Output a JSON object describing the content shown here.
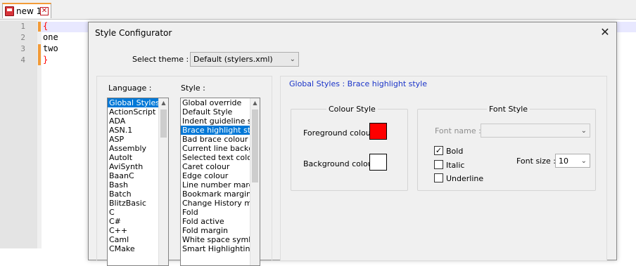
{
  "editor": {
    "tab_label": "new 1",
    "line_numbers": [
      "1",
      "2",
      "3",
      "4"
    ],
    "lines": [
      "{",
      "one",
      "two",
      "}"
    ]
  },
  "dialog": {
    "title": "Style Configurator",
    "close_glyph": "✕",
    "select_theme_label": "Select theme :",
    "theme_value": "Default (stylers.xml)",
    "language_label": "Language :",
    "style_label": "Style :",
    "languages": [
      "Global Styles",
      "ActionScript",
      "ADA",
      "ASN.1",
      "ASP",
      "Assembly",
      "AutoIt",
      "AviSynth",
      "BaanC",
      "Bash",
      "Batch",
      "BlitzBasic",
      "C",
      "C#",
      "C++",
      "Caml",
      "CMake"
    ],
    "selected_language": "Global Styles",
    "styles": [
      "Global override",
      "Default Style",
      "Indent guideline sty",
      "Brace highlight styl",
      "Bad brace colour",
      "Current line backgr",
      "Selected text colou",
      "Caret colour",
      "Edge colour",
      "Line number margin",
      "Bookmark margin",
      "Change History ma",
      "Fold",
      "Fold active",
      "Fold margin",
      "White space symbo",
      "Smart Highlighting"
    ],
    "selected_style": "Brace highlight styl",
    "style_heading": "Global Styles : Brace highlight style",
    "colour_style": {
      "legend": "Colour Style",
      "foreground_label": "Foreground colour",
      "background_label": "Background colour",
      "foreground_color": "#ff0000",
      "background_color": "#ffffff"
    },
    "font_style": {
      "legend": "Font Style",
      "font_name_label": "Font name :",
      "font_name_value": "",
      "bold_label": "Bold",
      "bold_checked": true,
      "italic_label": "Italic",
      "italic_checked": false,
      "underline_label": "Underline",
      "underline_checked": false,
      "font_size_label": "Font size :",
      "font_size_value": "10"
    }
  },
  "colors": {
    "selection": "#0078d7",
    "heading": "#1a34c8",
    "brace": "#ff0000"
  }
}
